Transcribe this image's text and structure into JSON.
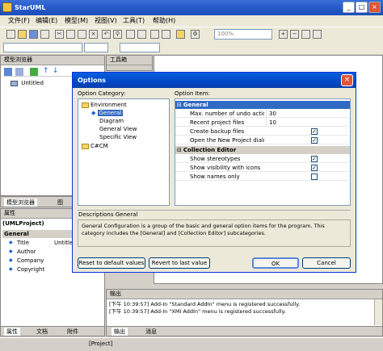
{
  "app": {
    "title": "StarUML",
    "minimize": "_",
    "maximize": "□",
    "close": "×"
  },
  "menu": [
    "文件(F)",
    "编辑(E)",
    "模型(M)",
    "视图(V)",
    "工具(T)",
    "帮助(H)"
  ],
  "toolbar": {
    "zoom": "100%"
  },
  "model_panel": {
    "title": "模型浏览器",
    "root_item": "Untitled",
    "tab_model": "模型浏览器",
    "tab_diagram": "图"
  },
  "toolbox_panel": {
    "title": "工具箱"
  },
  "props_panel": {
    "title": "属性",
    "header": "(UMLProject)",
    "group": "General",
    "rows": [
      {
        "name": "Title",
        "value": "Untitled"
      },
      {
        "name": "Author",
        "value": ""
      },
      {
        "name": "Company",
        "value": ""
      },
      {
        "name": "Copyright",
        "value": ""
      }
    ],
    "tab_props": "属性",
    "tab_docs": "文档",
    "tab_attach": "附件"
  },
  "output_panel": {
    "title": "输出",
    "lines": [
      "[下午 10:39:57]  Add-In \"Standard AddIn\" menu is registered successfully.",
      "[下午 10:39:57]  Add-In \"XMI AddIn\" menu is registered successfully."
    ],
    "tab_output": "输出",
    "tab_messages": "消息"
  },
  "status": {
    "text": "[Project]"
  },
  "dialog": {
    "title": "Options",
    "category_label": "Option Category:",
    "item_label": "Option Item:",
    "tree": {
      "environment": "Environment",
      "children": [
        "General",
        "Diagram",
        "General View",
        "Specific View"
      ],
      "cm": "C#CM"
    },
    "groups": [
      {
        "name": "General",
        "rows": [
          {
            "name": "Max. number of undo actions",
            "value": "30",
            "check": null
          },
          {
            "name": "Recent project files",
            "value": "10",
            "check": null
          },
          {
            "name": "Create backup files",
            "value": "",
            "check": true
          },
          {
            "name": "Open the New Project dialog bo",
            "value": "",
            "check": true
          }
        ]
      },
      {
        "name": "Collection Editor",
        "rows": [
          {
            "name": "Show stereotypes",
            "value": "",
            "check": true
          },
          {
            "name": "Show visibility with icons",
            "value": "",
            "check": true
          },
          {
            "name": "Show names only",
            "value": "",
            "check": false
          }
        ]
      }
    ],
    "description_title": "Descriptions General",
    "description": "General Configuration is a group of the basic and general option items for the program. This category includes the [General] and [Collection Editor] subcategories.",
    "buttons": {
      "reset": "Reset to default values",
      "revert": "Revert to last value",
      "ok": "OK",
      "cancel": "Cancel"
    }
  }
}
